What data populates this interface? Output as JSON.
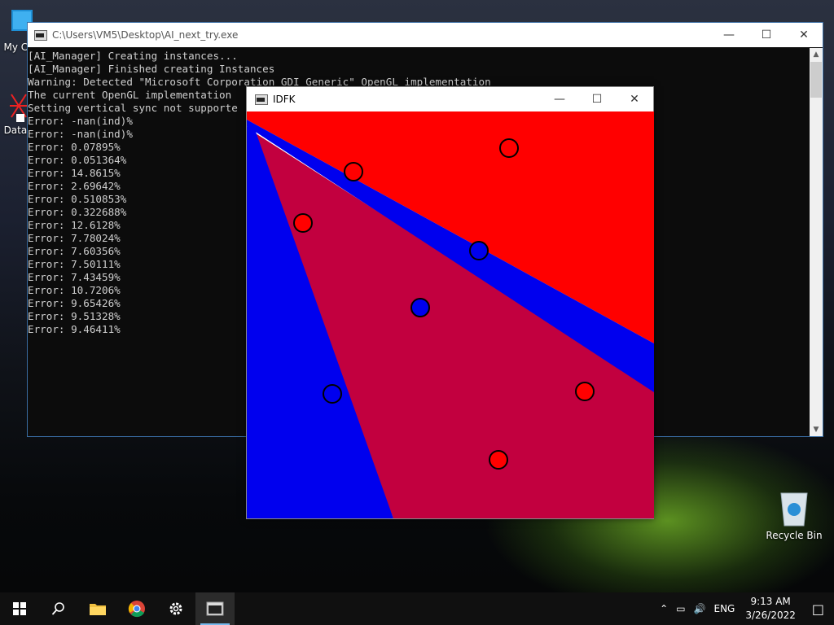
{
  "desktop": {
    "icons": [
      {
        "label": "My Co",
        "name": "my-computer"
      },
      {
        "label": "DataV",
        "name": "datav"
      },
      {
        "label": "Recycle Bin",
        "name": "recycle-bin"
      }
    ]
  },
  "console": {
    "title": "C:\\Users\\VM5\\Desktop\\AI_next_try.exe",
    "lines": [
      "[AI_Manager] Creating instances...",
      "[AI_Manager] Finished creating Instances",
      "Warning: Detected \"Microsoft Corporation GDI Generic\" OpenGL implementation",
      "The current OpenGL implementation",
      "Setting vertical sync not supporte",
      "Error: -nan(ind)%",
      "Error: -nan(ind)%",
      "Error: 0.07895%",
      "Error: 0.051364%",
      "Error: 14.8615%",
      "Error: 2.69642%",
      "Error: 0.510853%",
      "Error: 0.322688%",
      "Error: 12.6128%",
      "Error: 7.78024%",
      "Error: 7.60356%",
      "Error: 7.50111%",
      "Error: 7.43459%",
      "Error: 10.7206%",
      "Error: 9.65426%",
      "Error: 9.51328%",
      "Error: 9.46411%"
    ]
  },
  "idfk": {
    "title": "IDFK",
    "colors": {
      "red": "#ff0000",
      "blue": "#0000ee",
      "mix": "#c2003f"
    },
    "points": [
      {
        "cls": "red",
        "x": 0.644,
        "y": 0.09
      },
      {
        "cls": "red",
        "x": 0.262,
        "y": 0.148
      },
      {
        "cls": "red",
        "x": 0.138,
        "y": 0.274
      },
      {
        "cls": "blue",
        "x": 0.57,
        "y": 0.342
      },
      {
        "cls": "blue",
        "x": 0.426,
        "y": 0.482
      },
      {
        "cls": "blue",
        "x": 0.21,
        "y": 0.694
      },
      {
        "cls": "red",
        "x": 0.83,
        "y": 0.688
      },
      {
        "cls": "red",
        "x": 0.618,
        "y": 0.856
      }
    ]
  },
  "taskbar": {
    "language": "ENG",
    "time": "9:13 AM",
    "date": "3/26/2022"
  }
}
